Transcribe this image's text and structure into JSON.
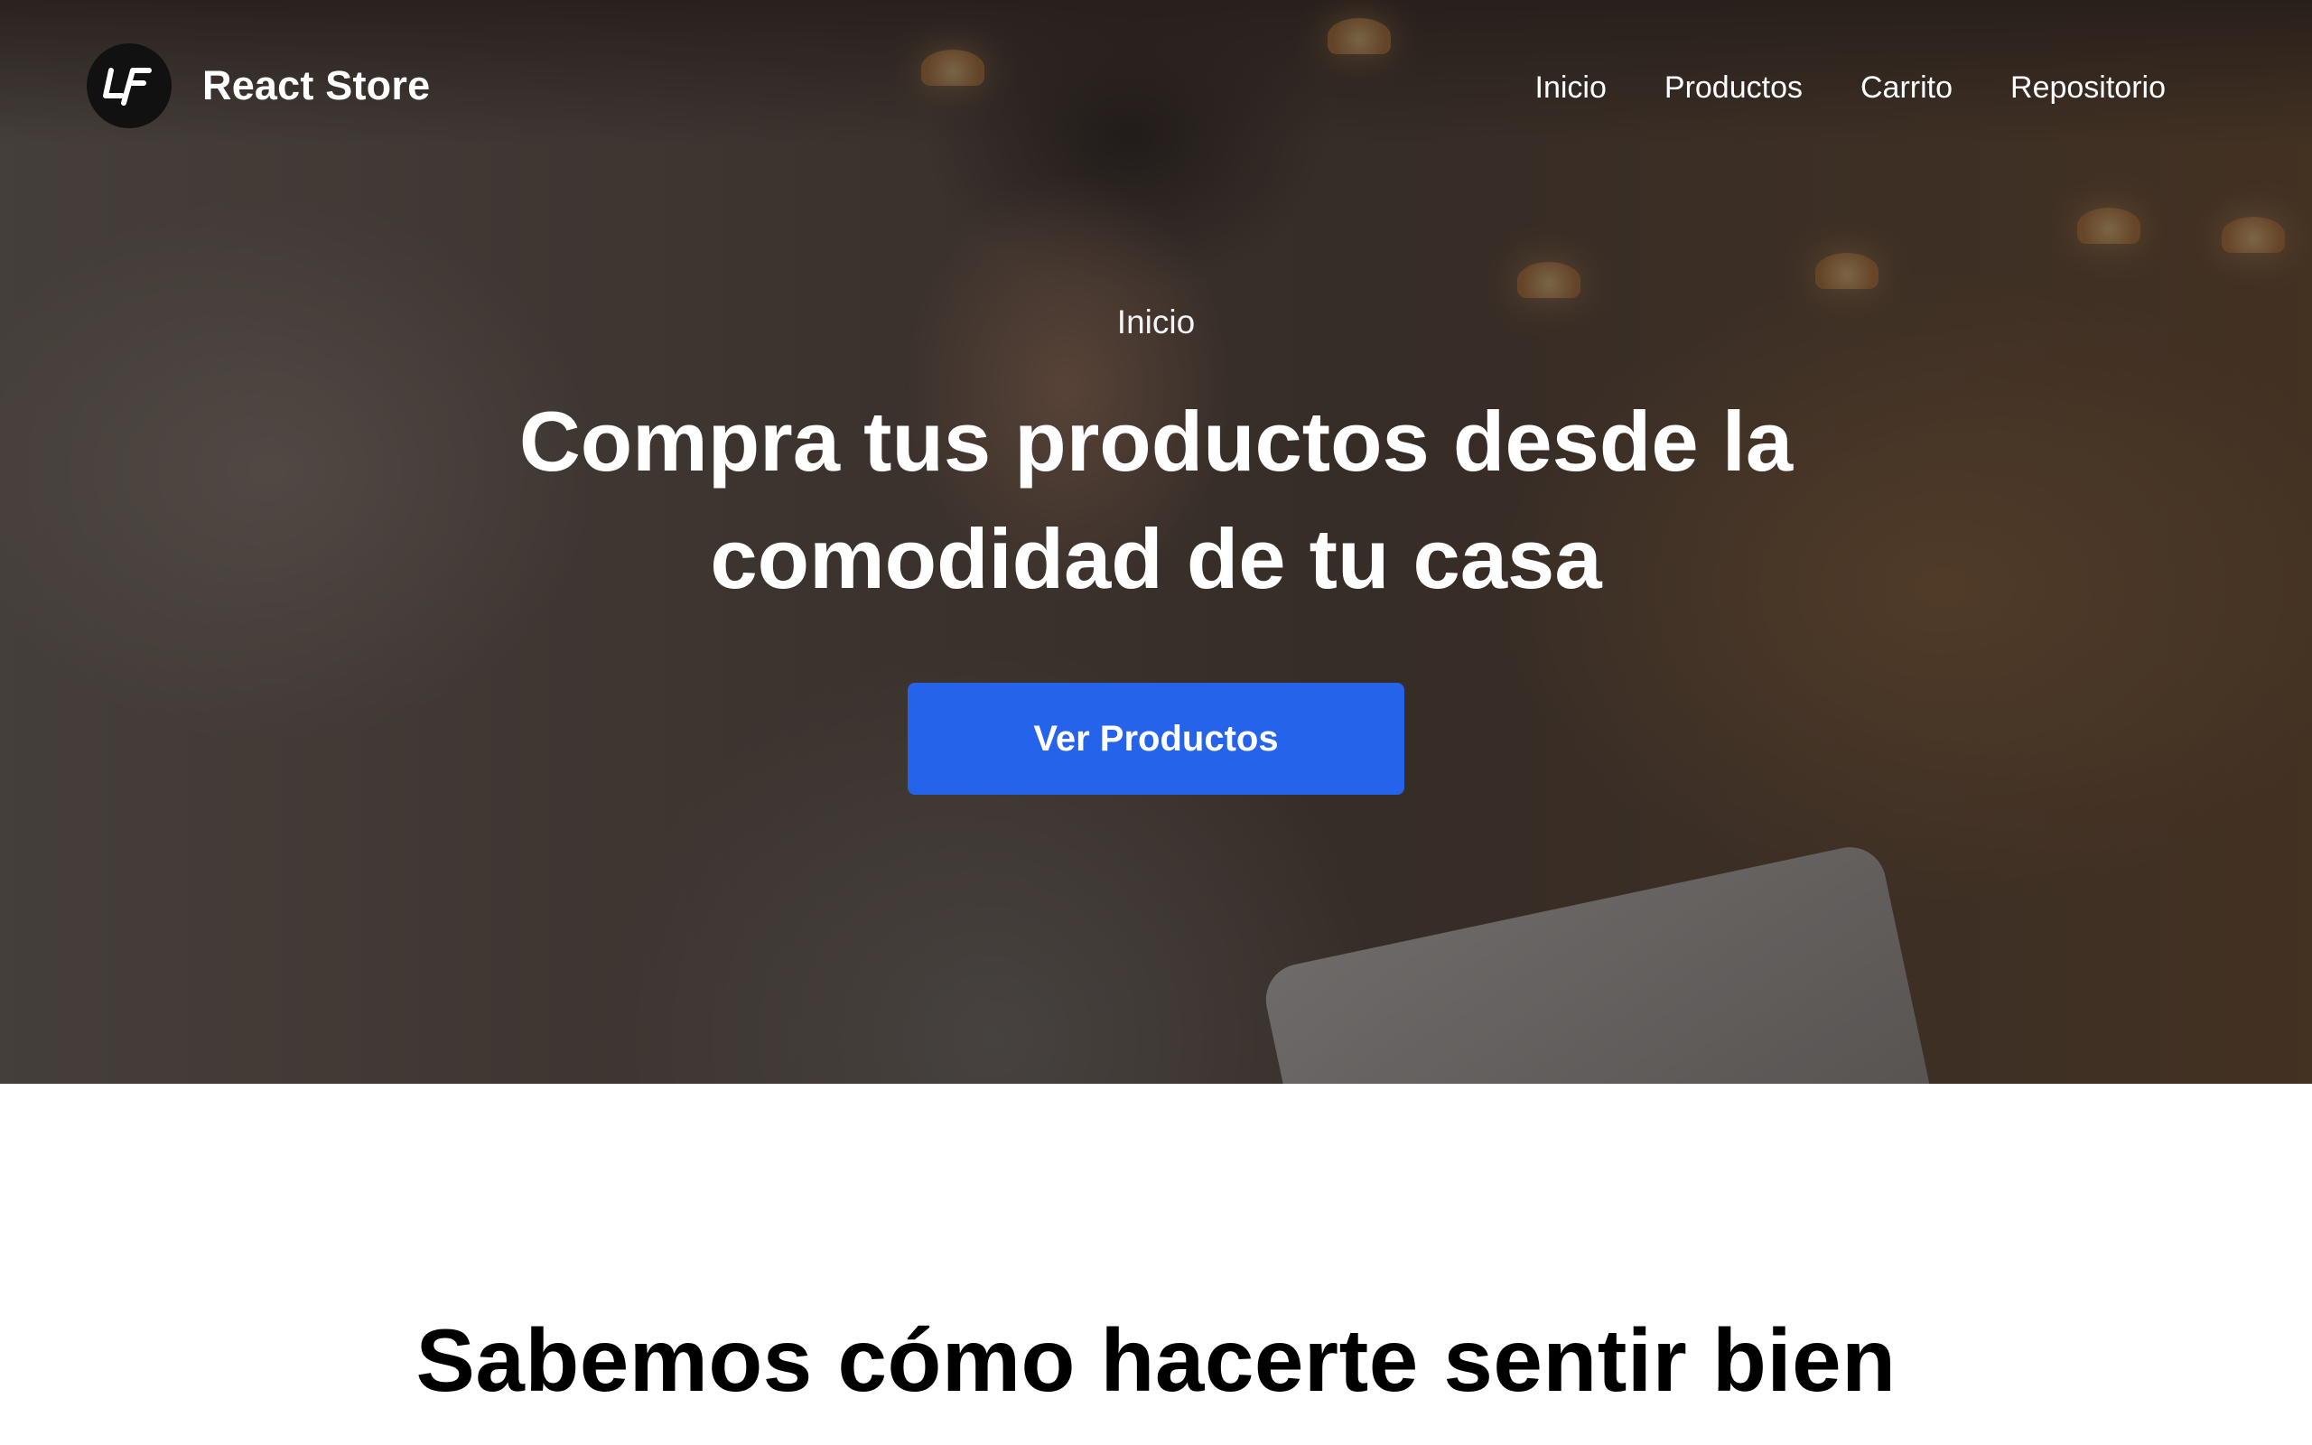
{
  "brand": {
    "name": "React Store",
    "logo_icon": "lf-logo-icon"
  },
  "nav": {
    "items": [
      {
        "label": "Inicio"
      },
      {
        "label": "Productos"
      },
      {
        "label": "Carrito"
      },
      {
        "label": "Repositorio"
      }
    ]
  },
  "hero": {
    "eyebrow": "Inicio",
    "title": "Compra tus productos desde la comodidad de tu casa",
    "cta_label": "Ver Productos",
    "background_image": "person-with-tablet-in-cafe"
  },
  "section": {
    "title": "Sabemos cómo hacerte sentir bien"
  },
  "colors": {
    "accent": "#2563eb",
    "text_light": "#ffffff",
    "text_dark": "#000000"
  }
}
